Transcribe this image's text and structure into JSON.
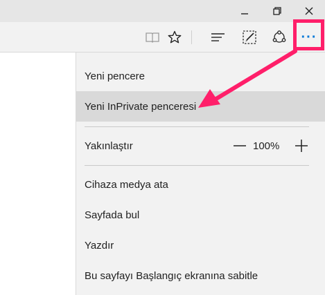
{
  "menu": {
    "new_window": "Yeni pencere",
    "new_inprivate": "Yeni InPrivate penceresi",
    "zoom_label": "Yakınlaştır",
    "zoom_value": "100%",
    "cast": "Cihaza medya ata",
    "find": "Sayfada bul",
    "print": "Yazdır",
    "pin": "Bu sayfayı Başlangıç ekranına sabitle"
  },
  "toolbar": {
    "more_label": "···"
  },
  "colors": {
    "highlight": "#ff1f6a",
    "accent": "#0078d7"
  },
  "icons": [
    "minimize-icon",
    "restore-icon",
    "close-icon",
    "reading-view-icon",
    "favorites-star-icon",
    "hub-icon",
    "web-note-icon",
    "share-icon",
    "more-actions-icon",
    "zoom-out-icon",
    "zoom-in-icon"
  ]
}
